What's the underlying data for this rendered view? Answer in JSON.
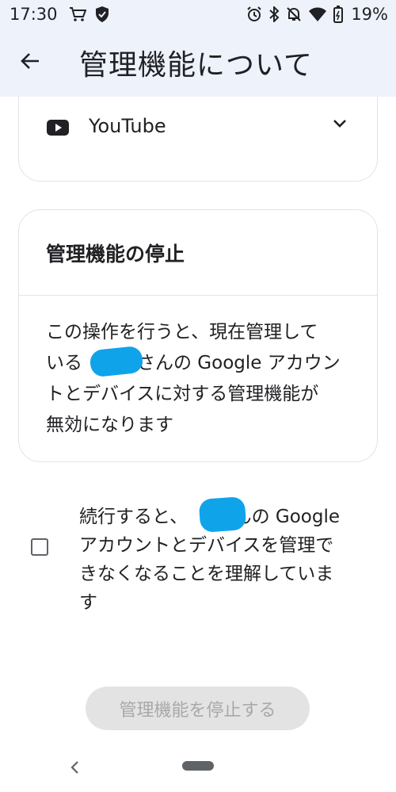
{
  "status_bar": {
    "time": "17:30",
    "left_icons": [
      "cart-icon",
      "shield-icon"
    ],
    "right_icons": [
      "alarm-icon",
      "bluetooth-icon",
      "mute-icon",
      "wifi-icon",
      "battery-icon"
    ],
    "battery": "19%"
  },
  "header": {
    "back_icon": "arrow-left-icon",
    "title": "管理機能について"
  },
  "youtube_card": {
    "icon": "youtube-icon",
    "label": "YouTube",
    "chevron": "chevron-down-icon"
  },
  "stop_card": {
    "title": "管理機能の停止",
    "body_lines": [
      "この操作を行うと、現在管理して",
      "いる　　　さんの Google アカウン",
      "トとデバイスに対する管理機能が",
      "無効になります"
    ]
  },
  "confirm": {
    "lines": [
      "続行すると、　　さんの Google",
      "アカウントとデバイスを管理で",
      "きなくなることを理解していま",
      "す"
    ],
    "checked": false
  },
  "stop_button": {
    "label": "管理機能を停止する",
    "enabled": false
  },
  "nav_bar": {
    "back_icon": "nav-back-icon",
    "home_icon": "nav-home-pill"
  },
  "colors": {
    "header_bg": "#eef2fb",
    "redaction": "#0fa3ea",
    "button_disabled_bg": "#e3e3e3",
    "button_disabled_text": "#a8a8a8"
  }
}
